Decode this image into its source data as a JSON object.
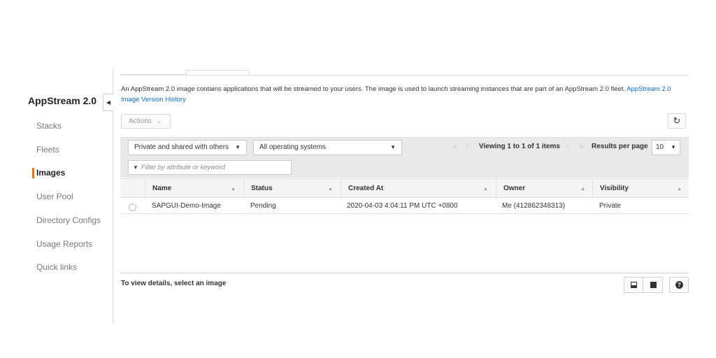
{
  "sidebar": {
    "title": "AppStream 2.0",
    "items": [
      {
        "label": "Stacks"
      },
      {
        "label": "Fleets"
      },
      {
        "label": "Images",
        "active": true
      },
      {
        "label": "User Pool"
      },
      {
        "label": "Directory Configs"
      },
      {
        "label": "Usage Reports"
      },
      {
        "label": "Quick links"
      }
    ]
  },
  "description": {
    "text": "An AppStream 2.0 image contains applications that will be streamed to your users. The image is used to launch streaming instances that are part of an AppStream 2.0 fleet.",
    "link": "AppStream 2.0 Image Version History"
  },
  "toolbar": {
    "actions_label": "Actions",
    "refresh_icon": "refresh-icon",
    "visibility_filter": "Private and shared with others",
    "os_filter": "All operating systems",
    "search_placeholder": "Filter by attribute or keyword",
    "pagination_text": "Viewing 1 to 1 of 1 items",
    "results_per_page_label": "Results per page",
    "results_per_page_value": "10"
  },
  "table": {
    "columns": [
      "Name",
      "Status",
      "Created At",
      "Owner",
      "Visibility"
    ],
    "rows": [
      {
        "name": "SAPGUI-Demo-Image",
        "status": "Pending",
        "created_at": "2020-04-03 4:04:11 PM UTC +0800",
        "owner": "Me (412862348313)",
        "visibility": "Private"
      }
    ]
  },
  "details": {
    "empty_text": "To view details, select an image"
  },
  "colors": {
    "accent": "#ec7211",
    "link": "#0a6bc2"
  }
}
